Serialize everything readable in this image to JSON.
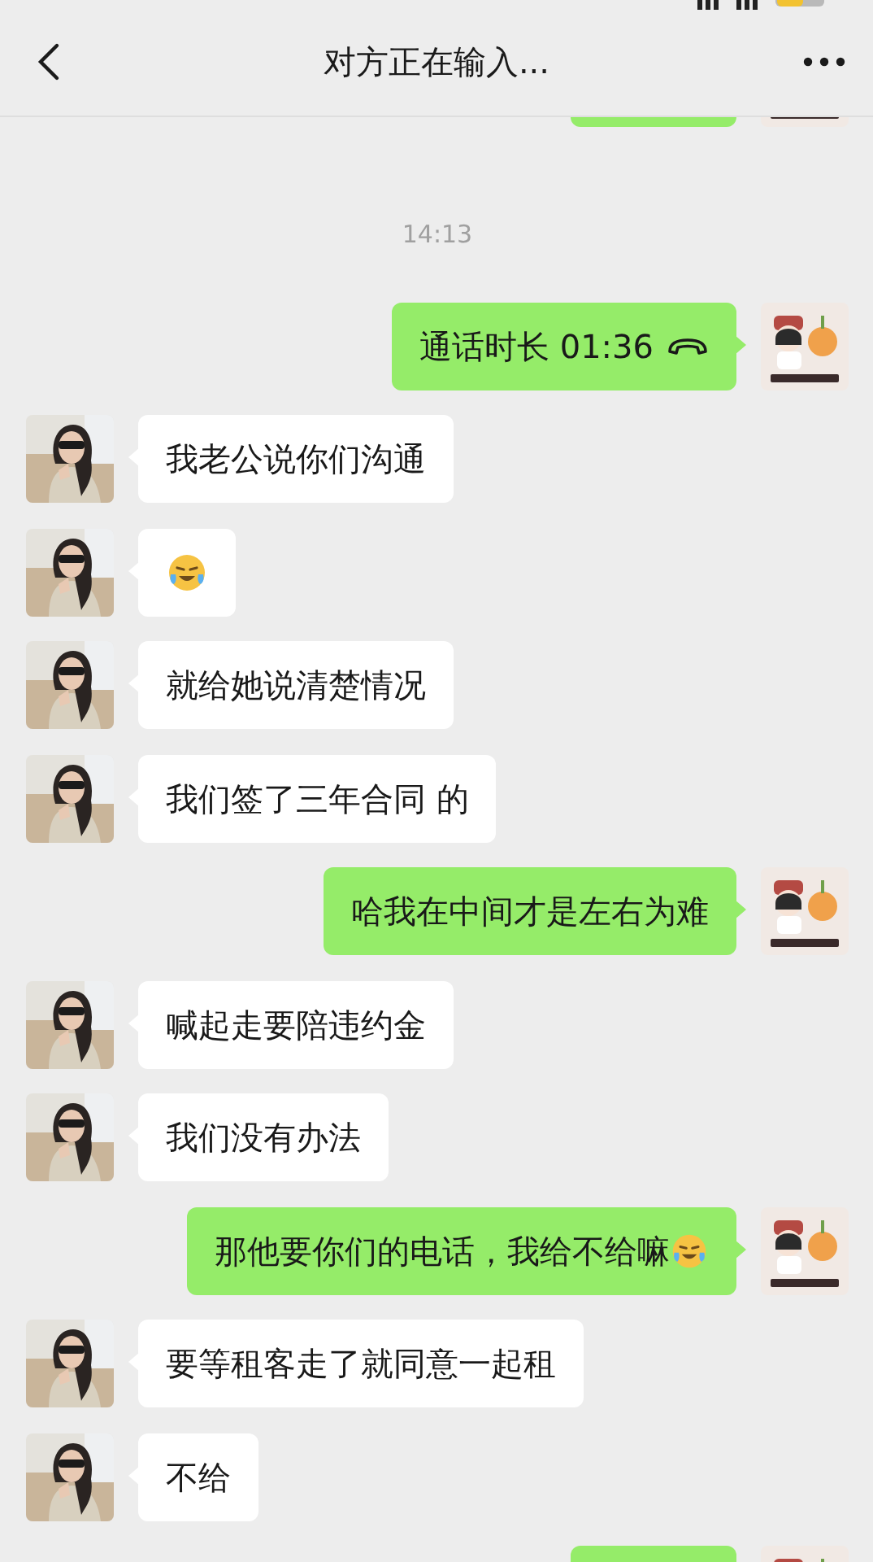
{
  "header": {
    "title": "对方正在输入..."
  },
  "messages": [
    {
      "kind": "cut",
      "outgoing": true
    },
    {
      "kind": "time",
      "text": "14:13"
    },
    {
      "kind": "call",
      "outgoing": true,
      "text": "通话时长 01:36"
    },
    {
      "kind": "text",
      "outgoing": false,
      "text": "我老公说你们沟通"
    },
    {
      "kind": "emoji",
      "outgoing": false
    },
    {
      "kind": "text",
      "outgoing": false,
      "text": "就给她说清楚情况"
    },
    {
      "kind": "text",
      "outgoing": false,
      "text": "我们签了三年合同 的"
    },
    {
      "kind": "text",
      "outgoing": true,
      "text": "哈我在中间才是左右为难"
    },
    {
      "kind": "text",
      "outgoing": false,
      "text": "喊起走要陪违约金"
    },
    {
      "kind": "text",
      "outgoing": false,
      "text": "我们没有办法"
    },
    {
      "kind": "text",
      "outgoing": true,
      "text": "那他要你们的电话，我给不给嘛",
      "trailing_emoji": true
    },
    {
      "kind": "text",
      "outgoing": false,
      "text": "要等租客走了就同意一起租"
    },
    {
      "kind": "text",
      "outgoing": false,
      "text": "不给"
    },
    {
      "kind": "cut",
      "outgoing": true
    }
  ]
}
